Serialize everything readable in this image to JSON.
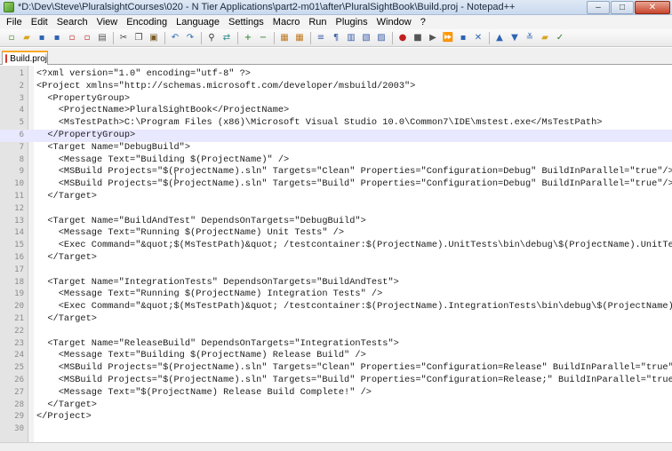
{
  "window": {
    "title": "*D:\\Dev\\Steve\\PluralsightCourses\\020 - N Tier Applications\\part2-m01\\after\\PluralSightBook\\Build.proj - Notepad++",
    "minimize": "–",
    "maximize": "□",
    "close": "✕"
  },
  "menu": [
    "File",
    "Edit",
    "Search",
    "View",
    "Encoding",
    "Language",
    "Settings",
    "Macro",
    "Run",
    "Plugins",
    "Window",
    "?"
  ],
  "toolbar_icons": [
    {
      "name": "new-file-icon",
      "glyph": "▫",
      "color": "#4c8a2c"
    },
    {
      "name": "open-file-icon",
      "glyph": "▰",
      "color": "#d9a521"
    },
    {
      "name": "save-icon",
      "glyph": "▪",
      "color": "#2d64b4"
    },
    {
      "name": "save-all-icon",
      "glyph": "▪",
      "color": "#2d64b4"
    },
    {
      "name": "close-icon",
      "glyph": "▫",
      "color": "#c03030"
    },
    {
      "name": "close-all-icon",
      "glyph": "▫",
      "color": "#c03030"
    },
    {
      "name": "print-icon",
      "glyph": "▤",
      "color": "#555"
    },
    {
      "name": "cut-icon",
      "glyph": "✂",
      "color": "#444"
    },
    {
      "name": "copy-icon",
      "glyph": "❐",
      "color": "#444"
    },
    {
      "name": "paste-icon",
      "glyph": "▣",
      "color": "#7a5c28"
    },
    {
      "name": "undo-icon",
      "glyph": "↶",
      "color": "#2f6fb8"
    },
    {
      "name": "redo-icon",
      "glyph": "↷",
      "color": "#2f6fb8"
    },
    {
      "name": "find-icon",
      "glyph": "⚲",
      "color": "#333"
    },
    {
      "name": "replace-icon",
      "glyph": "⇄",
      "color": "#2f8a8a"
    },
    {
      "name": "zoom-in-icon",
      "glyph": "+",
      "color": "#2a7a2a"
    },
    {
      "name": "zoom-out-icon",
      "glyph": "−",
      "color": "#2a7a2a"
    },
    {
      "name": "sync-vertical-icon",
      "glyph": "▦",
      "color": "#c07a20"
    },
    {
      "name": "sync-horizontal-icon",
      "glyph": "▦",
      "color": "#c07a20"
    },
    {
      "name": "word-wrap-icon",
      "glyph": "≡",
      "color": "#3a5fa8"
    },
    {
      "name": "show-all-chars-icon",
      "glyph": "¶",
      "color": "#3a5fa8"
    },
    {
      "name": "indent-guide-icon",
      "glyph": "▥",
      "color": "#3a5fa8"
    },
    {
      "name": "user-lang-icon",
      "glyph": "▧",
      "color": "#3a5fa8"
    },
    {
      "name": "doc-map-icon",
      "glyph": "▨",
      "color": "#3a5fa8"
    },
    {
      "name": "record-macro-icon",
      "glyph": "●",
      "color": "#c02020"
    },
    {
      "name": "stop-macro-icon",
      "glyph": "■",
      "color": "#555"
    },
    {
      "name": "play-macro-icon",
      "glyph": "▶",
      "color": "#555"
    },
    {
      "name": "run-macro-multiple-icon",
      "glyph": "⏩",
      "color": "#555"
    },
    {
      "name": "save-macro-icon",
      "glyph": "▪",
      "color": "#2d64b4"
    },
    {
      "name": "trim-icon",
      "glyph": "✕",
      "color": "#2d64b4"
    },
    {
      "name": "up-icon",
      "glyph": "▲",
      "color": "#2d64b4"
    },
    {
      "name": "down-icon",
      "glyph": "▼",
      "color": "#2d64b4"
    },
    {
      "name": "fold-icon",
      "glyph": "≚",
      "color": "#2d64b4"
    },
    {
      "name": "folder-icon",
      "glyph": "▰",
      "color": "#d9a521"
    },
    {
      "name": "spell-check-icon",
      "glyph": "✓",
      "color": "#2a7a2a"
    }
  ],
  "tab": {
    "label": "Build.proj"
  },
  "editor": {
    "current_line": 4,
    "lines": [
      {
        "n": "1",
        "text": "<?xml version=\"1.0\" encoding=\"utf-8\" ?>"
      },
      {
        "n": "2",
        "text": "<Project xmlns=\"http://schemas.microsoft.com/developer/msbuild/2003\">"
      },
      {
        "n": "3",
        "text": "  <PropertyGroup>"
      },
      {
        "n": "4",
        "text": "    <ProjectName>PluralSightBook</ProjectName>"
      },
      {
        "n": "5",
        "text": "    <MsTestPath>C:\\Program Files (x86)\\Microsoft Visual Studio 10.0\\Common7\\IDE\\mstest.exe</MsTestPath>"
      },
      {
        "n": "6",
        "text": "  </PropertyGroup>"
      },
      {
        "n": "7",
        "text": "  <Target Name=\"DebugBuild\">"
      },
      {
        "n": "8",
        "text": "    <Message Text=\"Building $(ProjectName)\" />"
      },
      {
        "n": "9",
        "text": "    <MSBuild Projects=\"$(ProjectName).sln\" Targets=\"Clean\" Properties=\"Configuration=Debug\" BuildInParallel=\"true\"/>"
      },
      {
        "n": "10",
        "text": "    <MSBuild Projects=\"$(ProjectName).sln\" Targets=\"Build\" Properties=\"Configuration=Debug\" BuildInParallel=\"true\"/>"
      },
      {
        "n": "11",
        "text": "  </Target>"
      },
      {
        "n": "12",
        "text": ""
      },
      {
        "n": "13",
        "text": "  <Target Name=\"BuildAndTest\" DependsOnTargets=\"DebugBuild\">"
      },
      {
        "n": "14",
        "text": "    <Message Text=\"Running $(ProjectName) Unit Tests\" />"
      },
      {
        "n": "15",
        "text": "    <Exec Command=\"&quot;$(MsTestPath)&quot; /testcontainer:$(ProjectName).UnitTests\\bin\\debug\\$(ProjectName).UnitTests.dll\" />"
      },
      {
        "n": "16",
        "text": "  </Target>"
      },
      {
        "n": "17",
        "text": ""
      },
      {
        "n": "18",
        "text": "  <Target Name=\"IntegrationTests\" DependsOnTargets=\"BuildAndTest\">"
      },
      {
        "n": "19",
        "text": "    <Message Text=\"Running $(ProjectName) Integration Tests\" />"
      },
      {
        "n": "20",
        "text": "    <Exec Command=\"&quot;$(MsTestPath)&quot; /testcontainer:$(ProjectName).IntegrationTests\\bin\\debug\\$(ProjectName).IntegrationTests.dll\" />"
      },
      {
        "n": "21",
        "text": "  </Target>"
      },
      {
        "n": "22",
        "text": ""
      },
      {
        "n": "23",
        "text": "  <Target Name=\"ReleaseBuild\" DependsOnTargets=\"IntegrationTests\">"
      },
      {
        "n": "24",
        "text": "    <Message Text=\"Building $(ProjectName) Release Build\" />"
      },
      {
        "n": "25",
        "text": "    <MSBuild Projects=\"$(ProjectName).sln\" Targets=\"Clean\" Properties=\"Configuration=Release\" BuildInParallel=\"true\"/>"
      },
      {
        "n": "26",
        "text": "    <MSBuild Projects=\"$(ProjectName).sln\" Targets=\"Build\" Properties=\"Configuration=Release;\" BuildInParallel=\"true\"/>"
      },
      {
        "n": "27",
        "text": "    <Message Text=\"$(ProjectName) Release Build Complete!\" />"
      },
      {
        "n": "28",
        "text": "  </Target>"
      },
      {
        "n": "29",
        "text": "</Project>"
      },
      {
        "n": "30",
        "text": ""
      }
    ]
  },
  "colors": {
    "accent_tab": "#f9a825",
    "current_line": "#e8e8ff",
    "gutter": "#e4e4e4"
  }
}
